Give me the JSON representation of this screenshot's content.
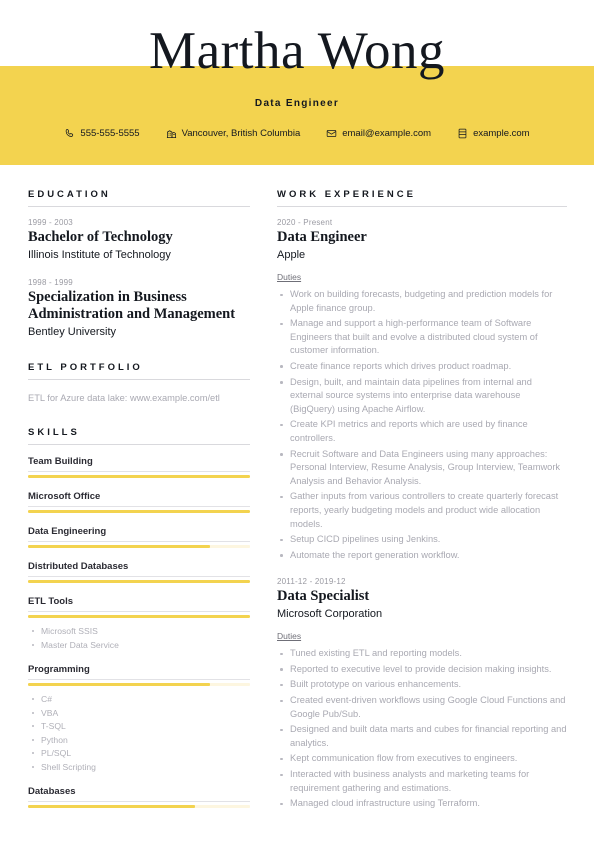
{
  "theme": {
    "accent": "#f3d34f",
    "accent_track": "#fdf6e0",
    "heading_color": "#14181f",
    "body_color": "#a9a9b2"
  },
  "header": {
    "full_name": "Martha Wong",
    "job_title": "Data Engineer",
    "contacts": [
      {
        "icon": "phone-icon",
        "text": "555-555-5555"
      },
      {
        "icon": "location-icon",
        "text": "Vancouver, British Columbia"
      },
      {
        "icon": "email-icon",
        "text": "email@example.com"
      },
      {
        "icon": "website-icon",
        "text": "example.com"
      }
    ]
  },
  "left_column": {
    "education": {
      "title": "EDUCATION",
      "entries": [
        {
          "date": "1999 - 2003",
          "degree": "Bachelor of Technology",
          "school": "Illinois Institute of Technology"
        },
        {
          "date": "1998 - 1999",
          "degree": "Specialization in Business Administration and Management",
          "school": "Bentley University"
        }
      ]
    },
    "portfolio": {
      "title": "ETL PORTFOLIO",
      "text": "ETL for Azure data lake: www.example.com/etl"
    },
    "skills": {
      "title": "SKILLS",
      "items": [
        {
          "name": "Team Building",
          "level": 100,
          "sub": []
        },
        {
          "name": "Microsoft Office",
          "level": 100,
          "sub": []
        },
        {
          "name": "Data Engineering",
          "level": 82,
          "sub": []
        },
        {
          "name": "Distributed Databases",
          "level": 100,
          "sub": []
        },
        {
          "name": "ETL Tools",
          "level": 100,
          "sub": [
            "Microsoft SSIS",
            "Master Data Service"
          ]
        },
        {
          "name": "Programming",
          "level": 82,
          "sub": [
            "C#",
            "VBA",
            "T-SQL",
            "Python",
            "PL/SQL",
            "Shell Scripting"
          ]
        },
        {
          "name": "Databases",
          "level": 75,
          "sub": []
        }
      ]
    }
  },
  "right_column": {
    "work_experience": {
      "title": "WORK EXPERIENCE",
      "duties_label": "Duties",
      "entries": [
        {
          "date": "2020 - Present",
          "role": "Data Engineer",
          "company": "Apple",
          "duties": [
            "Work on building forecasts, budgeting and prediction models for Apple finance group.",
            "Manage and support a high-performance team of Software Engineers that built and evolve a distributed cloud system of customer information.",
            "Create finance reports which drives product roadmap.",
            "Design, built, and maintain data pipelines from internal and external source systems into enterprise data warehouse (BigQuery) using Apache Airflow.",
            "Create KPI metrics and reports which are used by finance controllers.",
            "Recruit Software and Data Engineers using many approaches: Personal Interview, Resume Analysis, Group Interview, Teamwork Analysis and Behavior Analysis.",
            "Gather inputs from various controllers to create quarterly forecast reports, yearly budgeting models and product wide allocation models.",
            "Setup CICD pipelines using Jenkins.",
            "Automate the report generation workflow."
          ]
        },
        {
          "date": "2011-12 - 2019-12",
          "role": "Data Specialist",
          "company": "Microsoft Corporation",
          "duties": [
            "Tuned existing ETL and reporting models.",
            "Reported to executive level to provide decision making insights.",
            "Built prototype on various enhancements.",
            "Created event-driven workflows using Google Cloud Functions and Google Pub/Sub.",
            "Designed and built data marts and cubes for financial reporting and analytics.",
            "Kept communication flow from executives to engineers.",
            "Interacted with business analysts and marketing teams for requirement gathering and estimations.",
            "Managed cloud infrastructure using Terraform."
          ]
        }
      ]
    }
  }
}
